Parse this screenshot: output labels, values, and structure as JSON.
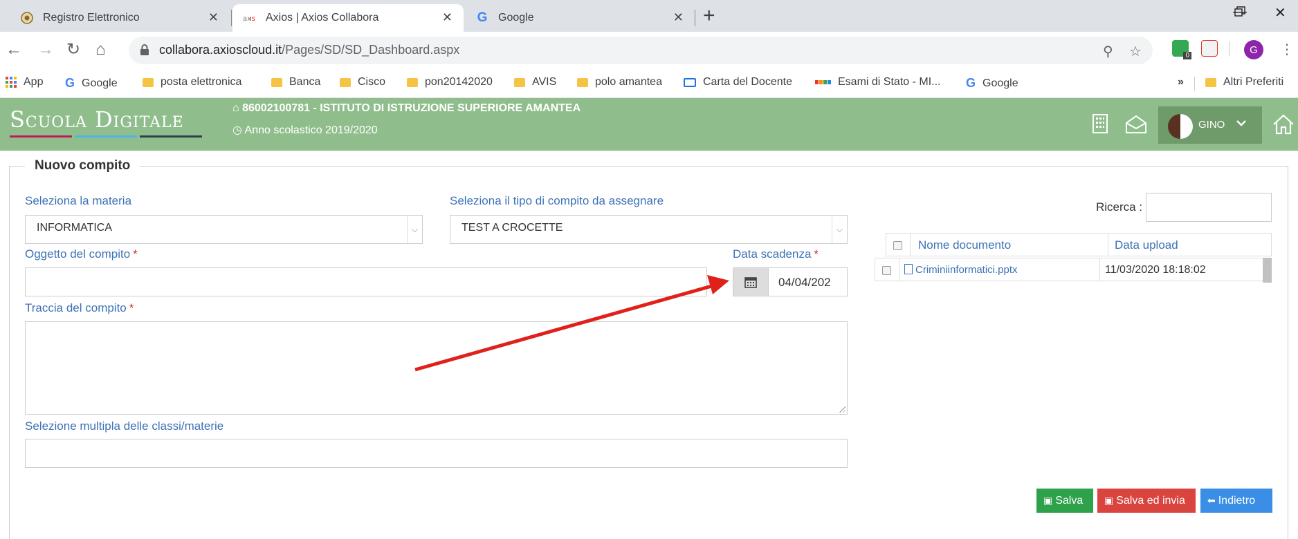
{
  "browser": {
    "tabs": [
      {
        "title": "Registro Elettronico",
        "icon": "seal-icon",
        "active": false
      },
      {
        "title": "Axios | Axios Collabora",
        "icon": "axios-icon",
        "active": true
      },
      {
        "title": "Google",
        "icon": "google-g-icon",
        "active": false
      }
    ],
    "url_host": "collabora.axioscloud.it",
    "url_path": "/Pages/SD/SD_Dashboard.aspx",
    "ext_badge": "0",
    "profile_initial": "G",
    "bookmarks": [
      {
        "label": "App",
        "icon": "apps-grid-icon"
      },
      {
        "label": "Google",
        "icon": "google-g-icon"
      },
      {
        "label": "posta elettronica",
        "icon": "folder-icon"
      },
      {
        "label": "Banca",
        "icon": "folder-icon"
      },
      {
        "label": "Cisco",
        "icon": "folder-icon"
      },
      {
        "label": "pon20142020",
        "icon": "folder-icon"
      },
      {
        "label": "AVIS",
        "icon": "folder-icon"
      },
      {
        "label": "polo amantea",
        "icon": "folder-icon"
      },
      {
        "label": "Carta del Docente",
        "icon": "card-icon"
      },
      {
        "label": "Esami di Stato - MI...",
        "icon": "ministry-icon"
      },
      {
        "label": "Google",
        "icon": "google-g-icon"
      }
    ],
    "bookmarks_overflow": "»",
    "other_bookmarks": "Altri Preferiti"
  },
  "app": {
    "logo": "Scuola Digitale",
    "school": "86002100781 - ISTITUTO DI ISTRUZIONE SUPERIORE AMANTEA",
    "year": "Anno scolastico 2019/2020",
    "user": "GINO",
    "header_color": "#8fbe8c"
  },
  "form": {
    "title": "Nuovo compito",
    "subject_label": "Seleziona la materia",
    "subject_value": "INFORMATICA",
    "type_label": "Seleziona il tipo di compito da assegnare",
    "type_value": "TEST A CROCETTE",
    "object_label": "Oggetto del compito",
    "deadline_label": "Data scadenza",
    "deadline_value": "04/04/202",
    "trace_label": "Traccia del compito",
    "multi_label": "Selezione multipla delle classi/materie",
    "required_mark": "*"
  },
  "documents": {
    "search_label": "Ricerca :",
    "columns": [
      "Nome documento",
      "Data upload"
    ],
    "rows": [
      {
        "name": "Criminiinformatici.pptx",
        "uploaded": "11/03/2020 18:18:02"
      }
    ]
  },
  "buttons": {
    "save": "Salva",
    "save_send": "Salva ed invia",
    "back": "Indietro",
    "colors": {
      "save": "#2ea24a",
      "save_send": "#d9443f",
      "back": "#3a8ee6"
    }
  },
  "annotation": {
    "arrow_color": "#e0211b"
  }
}
